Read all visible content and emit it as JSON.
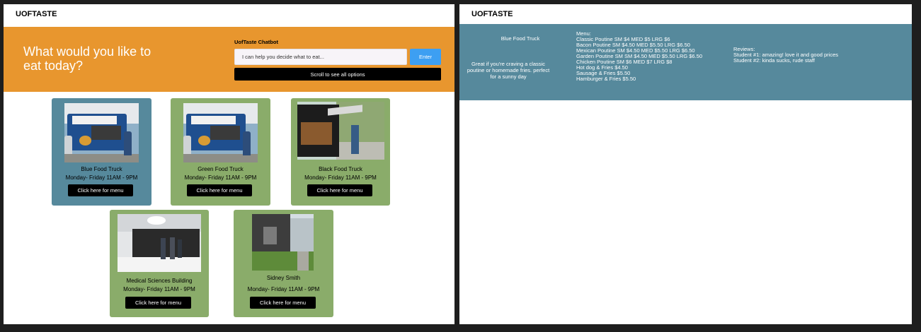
{
  "frame_labels": {
    "left": "",
    "right": ""
  },
  "left": {
    "nav_title": "UOFTASTE",
    "hero_title": "What would you like to eat today?",
    "chatbot": {
      "title": "UofTaste Chatbot",
      "placeholder": "I can help you decide what to eat...",
      "enter_label": "Enter",
      "scroll_label": "Scroll to see all options"
    },
    "cards": [
      {
        "name": "Blue Food Truck",
        "hours": "Monday- Friday 11AM - 9PM",
        "button": "Click here for menu",
        "color": "#56899c"
      },
      {
        "name": "Green Food Truck",
        "hours": "Monday- Friday 11AM - 9PM",
        "button": "Click here for menu",
        "color": "#8aac6a"
      },
      {
        "name": "Black Food Truck",
        "hours": "Monday- Friday 11AM - 9PM",
        "button": "Click here for menu",
        "color": "#8aac6a"
      },
      {
        "name": "Medical Sciences Building",
        "hours": "Monday- Friday 11AM - 9PM",
        "button": "Click here for menu",
        "color": "#8aac6a"
      },
      {
        "name": "Sidney Smith",
        "hours": "Monday- Friday 11AM - 9PM",
        "button": "Click here for menu",
        "color": "#8aac6a"
      }
    ]
  },
  "right": {
    "nav_title": "UOFTASTE",
    "panel_color": "#56899c",
    "truck_name": "Blue Food Truck",
    "description": "Great if you're craving a classic poutine or homemade fries. perfect for a sunny day",
    "menu_heading": "Menu:",
    "menu_items": [
      "Classic Poutine SM $4 MED $5 LRG $6",
      "Bacon Poutine SM $4.50 MED $5.50 LRG $6.50",
      "Mexican Poutine SM $4.50 MED $5.50 LRG $6.50",
      "Garden Poutine SM SM $4.50 MED $5.50 LRG $6.50",
      "Chicken Poutine SM $6 MED $7 LRG $8",
      "Hot dog & Fries $4.50",
      "Sausage & Fries $5.50",
      "Hamburger & Fries $5.50"
    ],
    "reviews_heading": "Reviews:",
    "reviews": [
      "Student #1: amazing! love it and good prices",
      "Student #2: kinda sucks, rude staff"
    ]
  },
  "colors": {
    "hero_orange": "#e8962e",
    "enter_blue": "#3d9ff2",
    "card_green": "#8aac6a",
    "card_blue": "#56899c"
  }
}
